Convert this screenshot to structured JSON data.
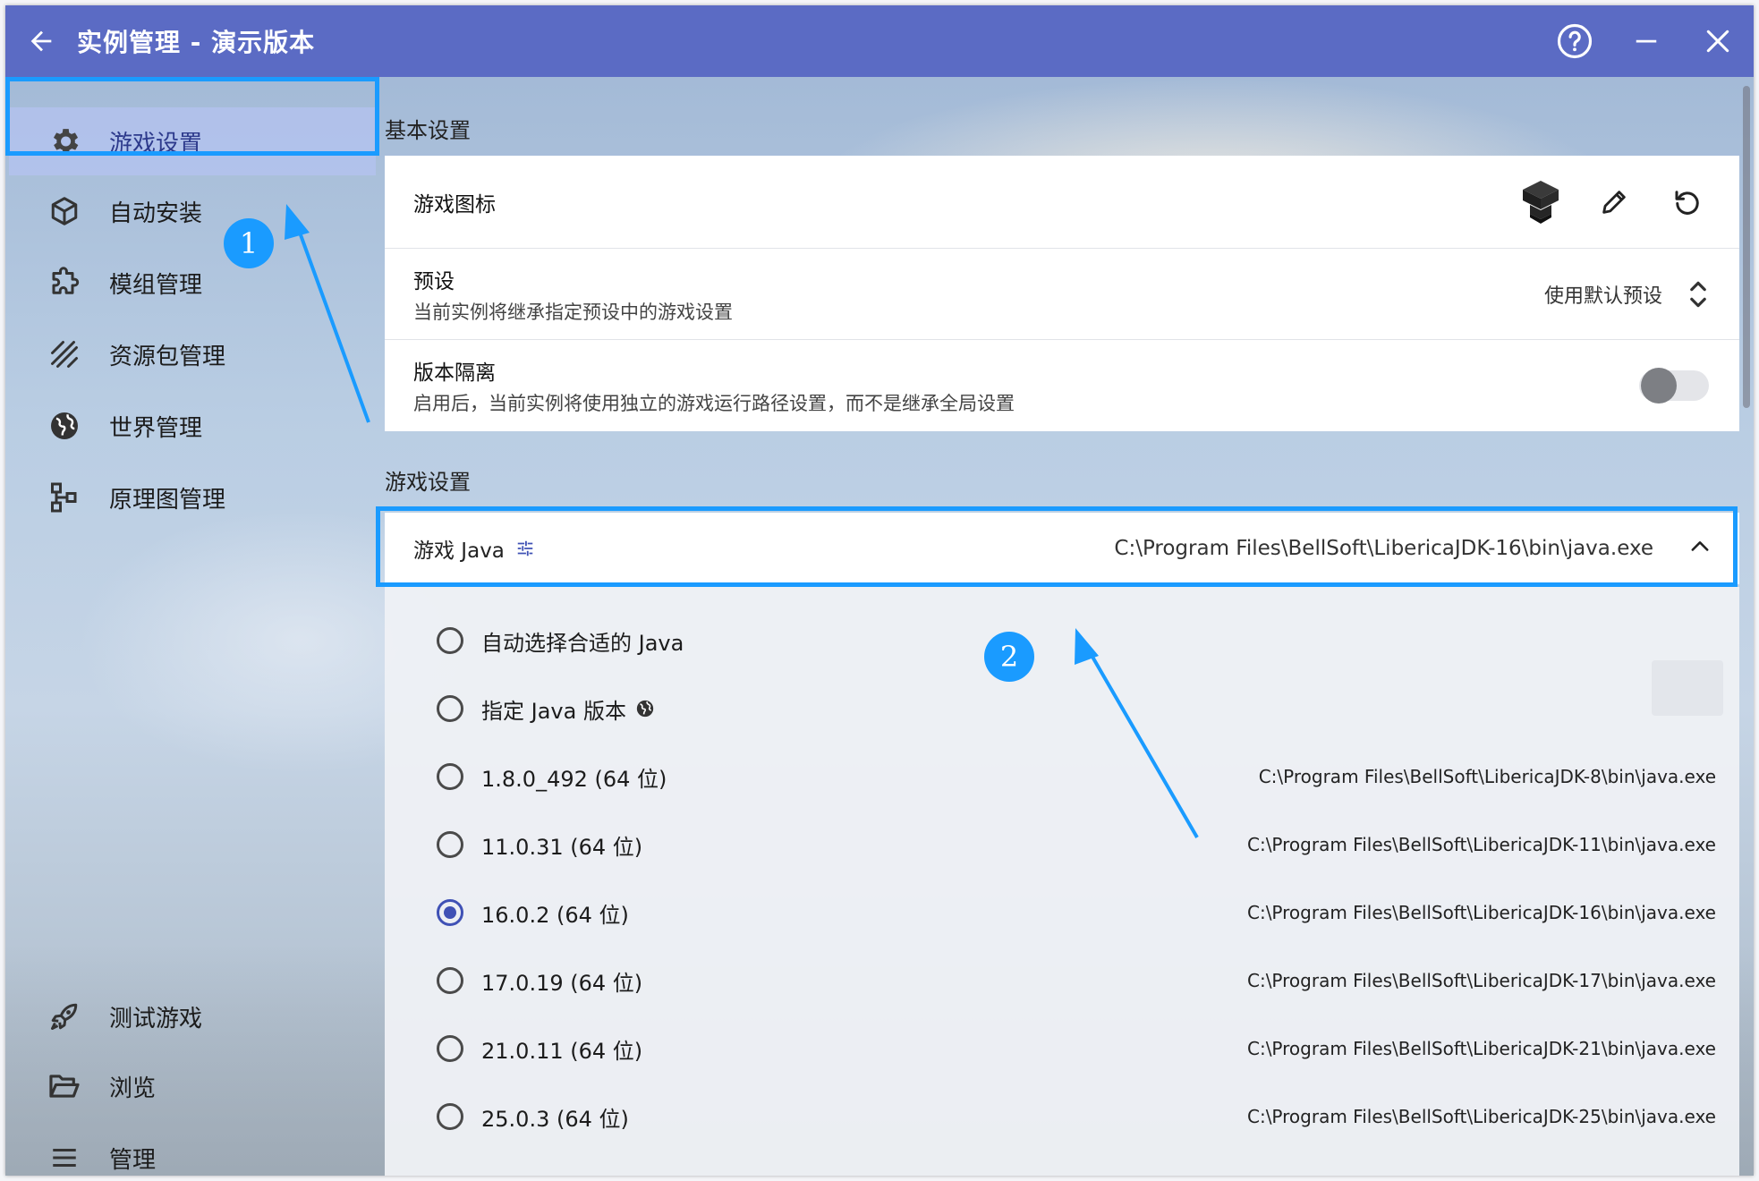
{
  "window": {
    "title": "实例管理 - 演示版本"
  },
  "sidebar": {
    "items": [
      {
        "label": "游戏设置",
        "icon": "gear-icon"
      },
      {
        "label": "自动安装",
        "icon": "cube-icon"
      },
      {
        "label": "模组管理",
        "icon": "puzzle-icon"
      },
      {
        "label": "资源包管理",
        "icon": "texture-icon"
      },
      {
        "label": "世界管理",
        "icon": "globe-icon"
      },
      {
        "label": "原理图管理",
        "icon": "schematic-icon"
      }
    ],
    "bottom_items": [
      {
        "label": "测试游戏",
        "icon": "rocket-icon"
      },
      {
        "label": "浏览",
        "icon": "folder-icon"
      },
      {
        "label": "管理",
        "icon": "menu-icon"
      }
    ]
  },
  "basic": {
    "section_title": "基本设置",
    "icon_row": {
      "title": "游戏图标"
    },
    "preset_row": {
      "title": "预设",
      "subtitle": "当前实例将继承指定预设中的游戏设置",
      "value": "使用默认预设"
    },
    "isolation_row": {
      "title": "版本隔离",
      "subtitle": "启用后，当前实例将使用独立的游戏运行路径设置，而不是继承全局设置",
      "enabled": false
    }
  },
  "game": {
    "section_title": "游戏设置",
    "java": {
      "title": "游戏 Java",
      "path": "C:\\Program Files\\BellSoft\\LibericaJDK-16\\bin\\java.exe",
      "options": [
        {
          "label": "自动选择合适的 Java",
          "path": "",
          "checked": false
        },
        {
          "label": "指定 Java 版本",
          "path": "",
          "checked": false
        },
        {
          "label": "1.8.0_492 (64 位)",
          "path": "C:\\Program Files\\BellSoft\\LibericaJDK-8\\bin\\java.exe",
          "checked": false
        },
        {
          "label": "11.0.31 (64 位)",
          "path": "C:\\Program Files\\BellSoft\\LibericaJDK-11\\bin\\java.exe",
          "checked": false
        },
        {
          "label": "16.0.2 (64 位)",
          "path": "C:\\Program Files\\BellSoft\\LibericaJDK-16\\bin\\java.exe",
          "checked": true
        },
        {
          "label": "17.0.19 (64 位)",
          "path": "C:\\Program Files\\BellSoft\\LibericaJDK-17\\bin\\java.exe",
          "checked": false
        },
        {
          "label": "21.0.11 (64 位)",
          "path": "C:\\Program Files\\BellSoft\\LibericaJDK-21\\bin\\java.exe",
          "checked": false
        },
        {
          "label": "25.0.3 (64 位)",
          "path": "C:\\Program Files\\BellSoft\\LibericaJDK-25\\bin\\java.exe",
          "checked": false
        }
      ]
    }
  },
  "annotations": {
    "badge1": "1",
    "badge2": "2"
  },
  "colors": {
    "titlebar": "#5b6bc4",
    "highlight": "#1a9bff",
    "accent": "#3f51b5"
  }
}
